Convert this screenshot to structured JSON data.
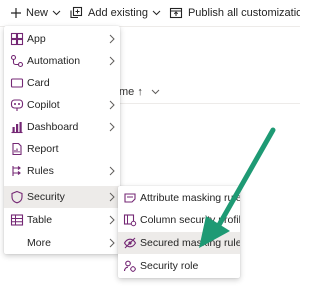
{
  "commandbar": {
    "new_label": "New",
    "add_existing_label": "Add existing",
    "publish_label": "Publish all customizations"
  },
  "background": {
    "column_header_fragment": "me ↑"
  },
  "menu": {
    "items": [
      {
        "label": "App",
        "icon": "app-icon",
        "has_submenu": true
      },
      {
        "label": "Automation",
        "icon": "automation-icon",
        "has_submenu": true
      },
      {
        "label": "Card",
        "icon": "card-icon",
        "has_submenu": false
      },
      {
        "label": "Copilot",
        "icon": "copilot-icon",
        "has_submenu": true
      },
      {
        "label": "Dashboard",
        "icon": "dashboard-icon",
        "has_submenu": true
      },
      {
        "label": "Report",
        "icon": "report-icon",
        "has_submenu": false
      },
      {
        "label": "Rules",
        "icon": "rules-icon",
        "has_submenu": true
      },
      {
        "label": "Security",
        "icon": "shield-icon",
        "has_submenu": true,
        "active": true
      },
      {
        "label": "Table",
        "icon": "table-icon",
        "has_submenu": true
      },
      {
        "label": "More",
        "icon": "",
        "has_submenu": true
      }
    ]
  },
  "submenu": {
    "items": [
      {
        "label": "Attribute masking rule",
        "icon": "attribute-masking-icon"
      },
      {
        "label": "Column security profile",
        "icon": "column-security-icon"
      },
      {
        "label": "Secured masking rule",
        "icon": "secured-masking-icon",
        "hover": true
      },
      {
        "label": "Security role",
        "icon": "security-role-icon"
      }
    ]
  },
  "colors": {
    "accent": "#742774",
    "arrow": "#1e9a74",
    "active_bg": "#edebe9"
  }
}
